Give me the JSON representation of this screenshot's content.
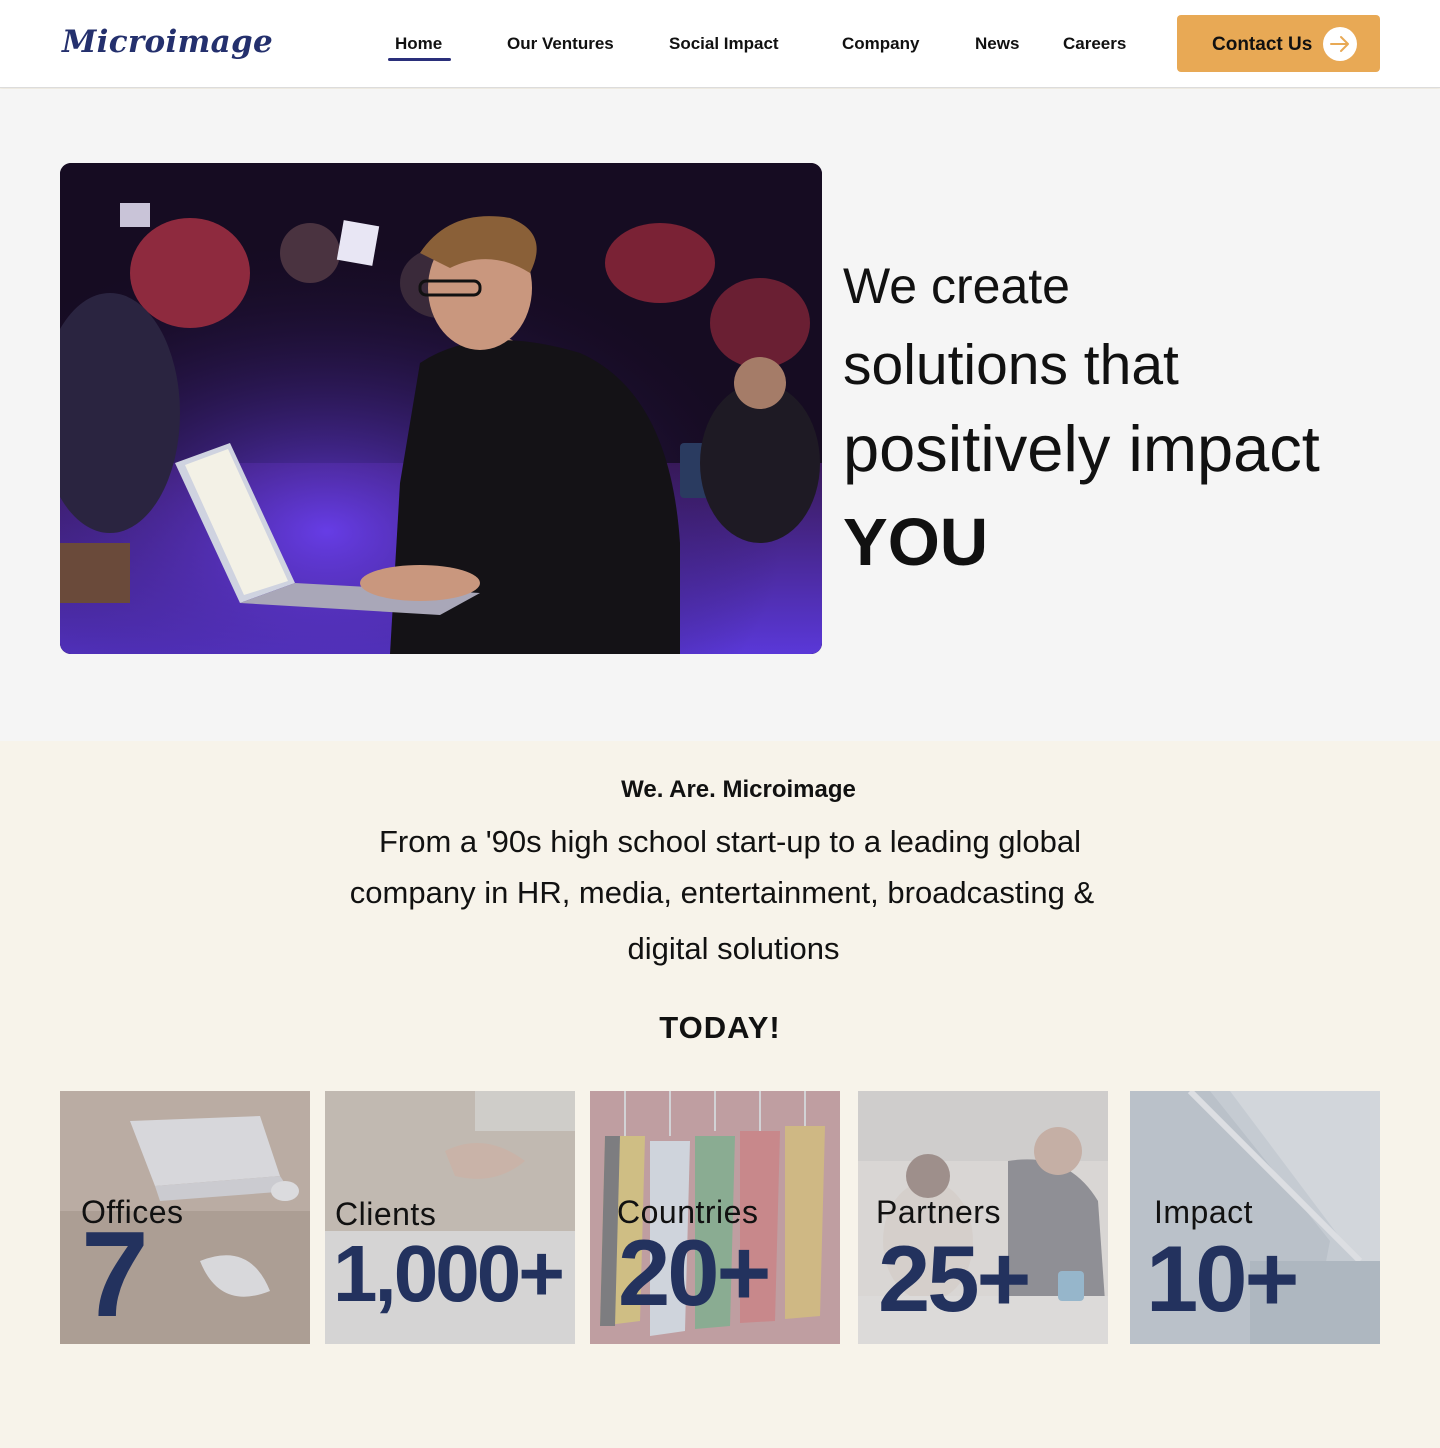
{
  "brand": {
    "logo": "Microimage"
  },
  "nav": {
    "items": [
      {
        "label": "Home",
        "active": true
      },
      {
        "label": "Our Ventures"
      },
      {
        "label": "Social Impact"
      },
      {
        "label": "Company"
      },
      {
        "label": "News"
      },
      {
        "label": "Careers"
      }
    ],
    "cta": {
      "label": "Contact Us",
      "icon": "arrow-right-icon"
    }
  },
  "hero": {
    "line1": "We create",
    "line2": "solutions that",
    "line3": "positively impact",
    "line4": "YOU",
    "image": "person-typing-on-laptop-at-hackathon"
  },
  "about": {
    "eyebrow": "We. Are. Microimage",
    "line1": "From a '90s high school start-up to a leading global",
    "line2": "company in HR, media, entertainment, broadcasting &",
    "line3": "digital solutions",
    "today": "TODAY!"
  },
  "stats": [
    {
      "label": "Offices",
      "value": "7",
      "image": "laptop-on-desk"
    },
    {
      "label": "Clients",
      "value": "1,000+",
      "image": "handshake"
    },
    {
      "label": "Countries",
      "value": "20+",
      "image": "national-flags"
    },
    {
      "label": "Partners",
      "value": "25+",
      "image": "people-working-at-table"
    },
    {
      "label": "Impact",
      "value": "10+",
      "image": "office-interior"
    }
  ],
  "colors": {
    "brand_navy": "#24306d",
    "cta_orange": "#e8a955",
    "stat_value": "#23325e",
    "about_bg": "#f7f3ea",
    "hero_bg": "#f5f5f5"
  }
}
